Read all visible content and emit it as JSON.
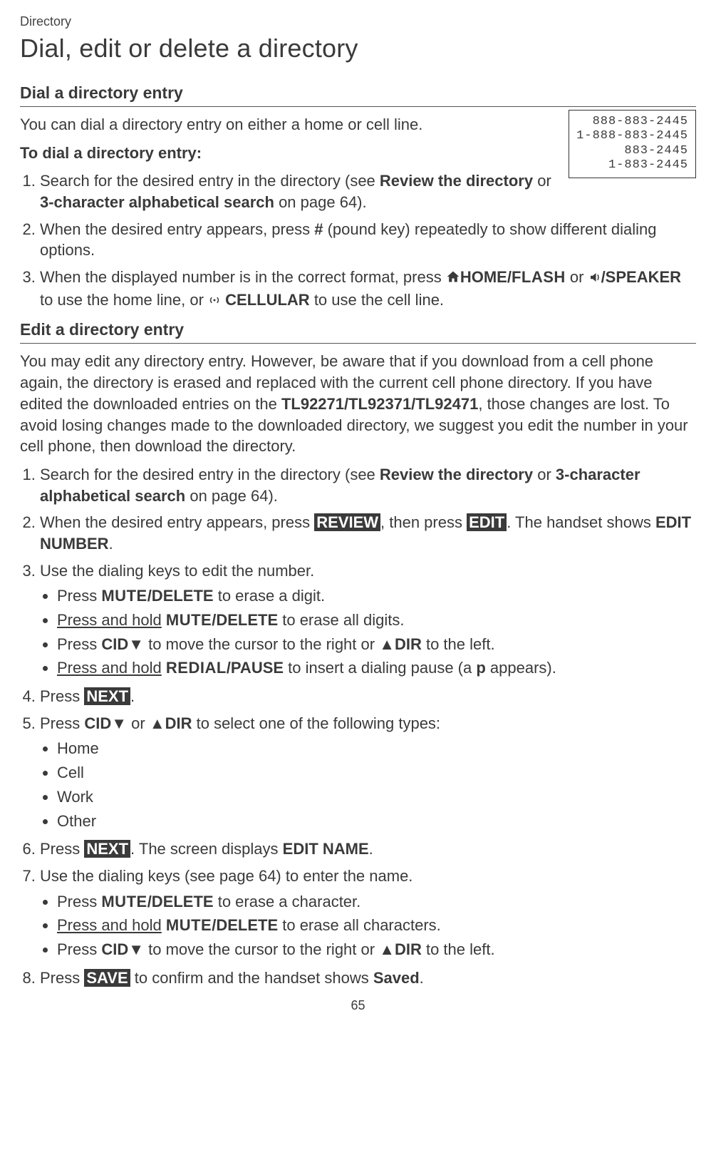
{
  "header": {
    "breadcrumb": "Directory",
    "title": "Dial, edit or delete a directory"
  },
  "section1": {
    "heading": "Dial a directory entry",
    "intro": "You can dial a directory entry on either a home or cell line.",
    "subhead": "To dial a directory entry:",
    "screen_lines": [
      "888-883-2445",
      "1-888-883-2445",
      "883-2445",
      "1-883-2445"
    ],
    "step1_a": "Search for the desired entry in the directory (see ",
    "step1_b": "Review the directory",
    "step1_c": " or ",
    "step1_d": "3-character alphabetical search",
    "step1_e": " on page 64).",
    "step2_a": "When the desired entry appears, press ",
    "step2_pound": "#",
    "step2_b": " (pound key) repeatedly to show different dialing options.",
    "step3_a": "When the displayed number is in the correct format, press ",
    "step3_home": "HOME/",
    "step3_flash": "FLASH",
    "step3_b": " or ",
    "step3_speaker": "/SPEAKER",
    "step3_c": " to use the home line, or ",
    "step3_cell": "CELLULAR",
    "step3_d": " to use the cell line."
  },
  "section2": {
    "heading": "Edit a directory entry",
    "intro_a": "You may edit any directory entry. However, be aware that if you download from a cell phone again, the directory is erased and replaced with the current cell phone directory. If you have edited the downloaded entries on the ",
    "models": "TL92271/TL92371/TL92471",
    "intro_b": ", those changes are lost. To avoid losing changes made to the downloaded directory, we suggest you edit the number in your cell phone, then download the directory.",
    "steps": {
      "s1_a": "Search for the desired entry in the directory (see ",
      "s1_b": "Review the directory",
      "s1_c": " or ",
      "s1_d": "3-character alphabetical search",
      "s1_e": " on page 64).",
      "s2_a": "When the desired entry appears, press ",
      "s2_review": "REVIEW",
      "s2_b": ", then press ",
      "s2_edit": "EDIT",
      "s2_c": ". The handset shows ",
      "s2_editnum": "EDIT NUMBER",
      "s2_d": ".",
      "s3": "Use the dialing keys to edit the number.",
      "s3_b1_a": "Press ",
      "mute_del_sc": "MUTE",
      "mute_del_b": "/DELETE",
      "s3_b1_b": " to erase a digit.",
      "s3_b2_a": "Press and hold",
      "s3_b2_b": " to erase all digits.",
      "s3_b3_a": "Press ",
      "cid_down": "CID",
      "s3_b3_b": " to move the cursor to the right or ",
      "dir_up": "DIR",
      "s3_b3_c": " to the left.",
      "s3_b4_a": "Press and hold",
      "redial_sc": "REDIAL",
      "redial_b": "/PAUSE",
      "s3_b4_b": " to insert a dialing pause (a ",
      "s3_b4_p": "p",
      "s3_b4_c": " appears).",
      "s4_a": "Press ",
      "s4_next": "NEXT",
      "s4_b": ".",
      "s5_a": "Press ",
      "s5_b": " or ",
      "s5_c": " to select one of the following types:",
      "types": [
        "Home",
        "Cell",
        "Work",
        "Other"
      ],
      "s6_a": "Press ",
      "s6_next": "NEXT",
      "s6_b": ". The screen displays ",
      "s6_editname": "EDIT NAME",
      "s6_c": ".",
      "s7": "Use the dialing keys (see page 64) to enter the name.",
      "s7_b1_b": " to erase a character.",
      "s7_b2_b": " to erase all characters.",
      "s8_a": "Press ",
      "s8_save": "SAVE",
      "s8_b": " to confirm and the handset shows ",
      "s8_saved": "Saved",
      "s8_c": "."
    }
  },
  "page_number": "65"
}
